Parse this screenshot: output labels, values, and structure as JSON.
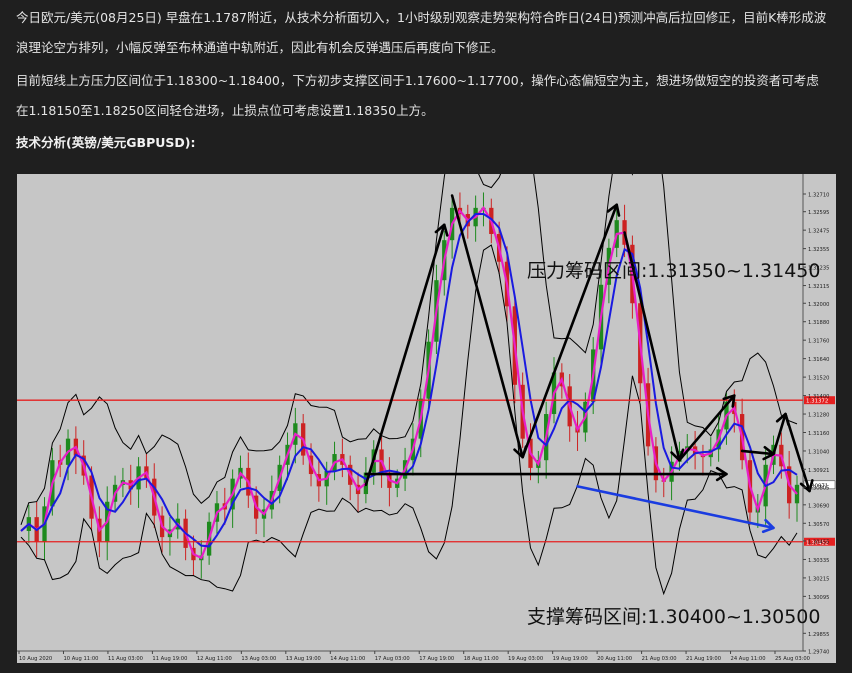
{
  "article": {
    "paragraph1": "今日欧元/美元(08月25日) 早盘在1.1787附近，从技术分析面切入，1小时级别观察走势架构符合昨日(24日)预测冲高后拉回修正，目前K棒形成波浪理论空方排列，小幅反弹至布林通道中轨附近，因此有机会反弹遇压后再度向下修正。",
    "paragraph2": "目前短线上方压力区间位于1.18300~1.18400，下方初步支撑区间于1.17600~1.17700，操作心态偏短空为主，想进场做短空的投资者可考虑在1.18150至1.18250区间轻仓进场，止损点位可考虑设置1.18350上方。",
    "heading": "技术分析(英镑/美元GBPUSD):"
  },
  "colors": {
    "chart_bg": "#c6c6c6",
    "candle_up": "#1e8a1e",
    "candle_down": "#cc2222",
    "ma_fast": "#e81fc8",
    "ma_slow": "#1a1ae0",
    "bands": "#000000",
    "level_line": "#e52020",
    "trend_arrow": "#1a3ce0"
  },
  "chart_data": {
    "type": "line",
    "symbol": "GBPUSD",
    "timeframe": "H1",
    "ylim": [
      1.2974,
      1.3284
    ],
    "y_ticks": [
      "1.32710",
      "1.32595",
      "1.32475",
      "1.32355",
      "1.32235",
      "1.32115",
      "1.32000",
      "1.31880",
      "1.31760",
      "1.31640",
      "1.31520",
      "1.31400",
      "1.31280",
      "1.31160",
      "1.31040",
      "1.30921",
      "1.30805",
      "1.30690",
      "1.30570",
      "1.30455",
      "1.30335",
      "1.30215",
      "1.30095",
      "1.29855",
      "1.29740"
    ],
    "x_ticks": [
      "10 Aug 2020",
      "10 Aug 11:00",
      "11 Aug 03:00",
      "11 Aug 19:00",
      "12 Aug 11:00",
      "13 Aug 03:00",
      "13 Aug 19:00",
      "14 Aug 11:00",
      "17 Aug 03:00",
      "17 Aug 19:00",
      "18 Aug 11:00",
      "19 Aug 03:00",
      "19 Aug 19:00",
      "20 Aug 11:00",
      "21 Aug 03:00",
      "21 Aug 19:00",
      "24 Aug 11:00",
      "25 Aug 03:00"
    ],
    "current_price_tag": "1.30971",
    "resistance_tag": "1.31372",
    "support_tag": "1.30452",
    "annotations": {
      "resistance": "压力筹码区间:1.31350~1.31450",
      "support": "支撑筹码区间:1.30400~1.30500"
    },
    "resistance_level": 1.3137,
    "support_level": 1.3045,
    "price_path": [
      1.3052,
      1.3061,
      1.3045,
      1.3068,
      1.3098,
      1.3095,
      1.3112,
      1.3101,
      1.3088,
      1.306,
      1.3045,
      1.3071,
      1.3082,
      1.3085,
      1.3079,
      1.3094,
      1.3086,
      1.3062,
      1.3048,
      1.3053,
      1.306,
      1.3041,
      1.3033,
      1.3036,
      1.3058,
      1.307,
      1.3066,
      1.3086,
      1.3093,
      1.3075,
      1.306,
      1.3066,
      1.3078,
      1.3095,
      1.3108,
      1.3122,
      1.3101,
      1.3089,
      1.3081,
      1.3091,
      1.3102,
      1.3095,
      1.3082,
      1.3076,
      1.309,
      1.3105,
      1.309,
      1.308,
      1.3086,
      1.3098,
      1.3112,
      1.3138,
      1.3175,
      1.3215,
      1.3241,
      1.3262,
      1.3258,
      1.325,
      1.3262,
      1.3262,
      1.3245,
      1.3227,
      1.3198,
      1.3147,
      1.3112,
      1.3093,
      1.3098,
      1.3128,
      1.3155,
      1.3146,
      1.312,
      1.3116,
      1.3136,
      1.317,
      1.3212,
      1.3236,
      1.3254,
      1.3238,
      1.32,
      1.3148,
      1.3107,
      1.3085,
      1.3084,
      1.3097,
      1.3104,
      1.3107,
      1.3102,
      1.31,
      1.3105,
      1.3118,
      1.3136,
      1.3128,
      1.3098,
      1.3064,
      1.3068,
      1.3095,
      1.3108,
      1.3094,
      1.307,
      1.3082
    ]
  }
}
